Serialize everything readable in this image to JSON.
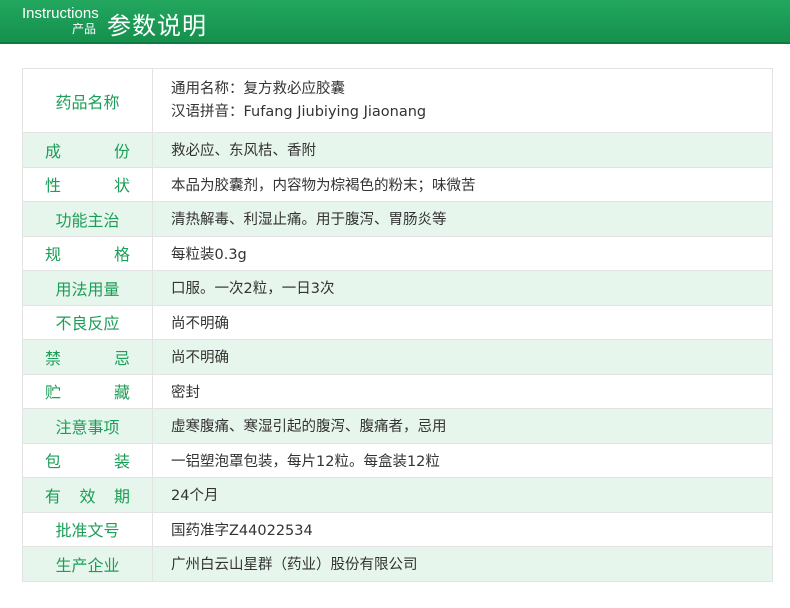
{
  "header": {
    "en_title": "Instructions",
    "small_title": "产品",
    "big_title": "参数说明"
  },
  "rows": [
    {
      "label": [
        "药品名称"
      ],
      "values": [
        "通用名称：复方救必应胶囊",
        "汉语拼音：Fufang Jiubiying Jiaonang"
      ]
    },
    {
      "label": [
        "成",
        "份"
      ],
      "values": [
        "救必应、东风桔、香附"
      ]
    },
    {
      "label": [
        "性",
        "状"
      ],
      "values": [
        "本品为胶囊剂，内容物为棕褐色的粉末；味微苦"
      ]
    },
    {
      "label": [
        "功能主治"
      ],
      "values": [
        "清热解毒、利湿止痛。用于腹泻、胃肠炎等"
      ]
    },
    {
      "label": [
        "规",
        "格"
      ],
      "values": [
        "每粒装0.3g"
      ]
    },
    {
      "label": [
        "用法用量"
      ],
      "values": [
        "口服。一次2粒，一日3次"
      ]
    },
    {
      "label": [
        "不良反应"
      ],
      "values": [
        "尚不明确"
      ]
    },
    {
      "label": [
        "禁",
        "忌"
      ],
      "values": [
        "尚不明确"
      ]
    },
    {
      "label": [
        "贮",
        "藏"
      ],
      "values": [
        "密封"
      ]
    },
    {
      "label": [
        "注意事项"
      ],
      "values": [
        "虚寒腹痛、寒湿引起的腹泻、腹痛者，忌用"
      ]
    },
    {
      "label": [
        "包",
        "装"
      ],
      "values": [
        "一铝塑泡罩包装，每片12粒。每盒装12粒"
      ]
    },
    {
      "label": [
        "有",
        "效",
        "期"
      ],
      "values": [
        "24个月"
      ]
    },
    {
      "label": [
        "批准文号"
      ],
      "values": [
        "国药准字Z44022534"
      ]
    },
    {
      "label": [
        "生产企业"
      ],
      "values": [
        "广州白云山星群（药业）股份有限公司"
      ]
    }
  ],
  "colors": {
    "banner_green": "#1b9e57",
    "label_green": "#1b9e57",
    "stripe": "#e7f6ec"
  }
}
